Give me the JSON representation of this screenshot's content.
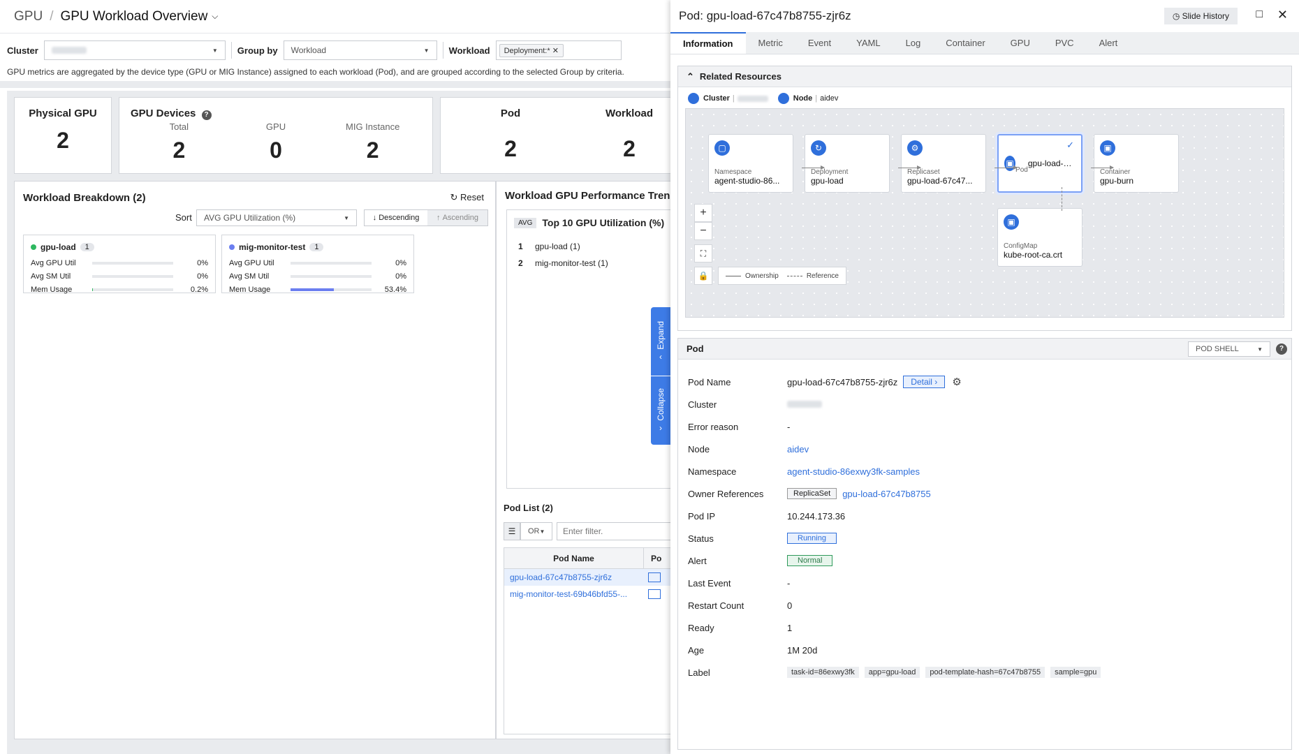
{
  "header": {
    "crumb": "GPU",
    "title": "GPU Workload Overview"
  },
  "filters": {
    "cluster_label": "Cluster",
    "groupby_label": "Group by",
    "groupby_value": "Workload",
    "workload_label": "Workload",
    "workload_tag": "Deployment:*"
  },
  "note": "GPU metrics are aggregated by the device type (GPU or MIG Instance) assigned to each workload (Pod), and are grouped according to the selected Group by criteria.",
  "stats": {
    "physical_gpu_label": "Physical GPU",
    "physical_gpu": "2",
    "devices_label": "GPU Devices",
    "total_label": "Total",
    "total": "2",
    "gpu_label": "GPU",
    "gpu": "0",
    "mig_label": "MIG Instance",
    "mig": "2",
    "pod_label": "Pod",
    "pod": "2",
    "workload_label": "Workload",
    "workload": "2"
  },
  "breakdown": {
    "title": "Workload Breakdown (2)",
    "reset": "Reset",
    "sort_label": "Sort",
    "sort_value": "AVG GPU Utilization (%)",
    "descending": "Descending",
    "ascending": "Ascending",
    "cards": [
      {
        "name": "gpu-load",
        "count": "1",
        "dot": "#2eb860",
        "rows": [
          {
            "k": "Avg GPU Util",
            "v": "0%",
            "fill": 0
          },
          {
            "k": "Avg SM Util",
            "v": "0%",
            "fill": 0
          },
          {
            "k": "Mem Usage",
            "v": "0.2%",
            "fill": 0.002
          }
        ]
      },
      {
        "name": "mig-monitor-test",
        "count": "1",
        "dot": "#6b7ef0",
        "rows": [
          {
            "k": "Avg GPU Util",
            "v": "0%",
            "fill": 0
          },
          {
            "k": "Avg SM Util",
            "v": "0%",
            "fill": 0
          },
          {
            "k": "Mem Usage",
            "v": "53.4%",
            "fill": 0.534
          }
        ]
      }
    ]
  },
  "trend": {
    "title": "Workload GPU Performance Trend",
    "avg_tag": "AVG",
    "subtitle": "Top 10 GPU Utilization (%)",
    "items": [
      {
        "rank": "1",
        "name": "gpu-load (1)"
      },
      {
        "rank": "2",
        "name": "mig-monitor-test (1)"
      }
    ],
    "expand": "Expand",
    "collapse": "Collapse"
  },
  "podlist": {
    "title": "Pod List (2)",
    "or": "OR",
    "filter_placeholder": "Enter filter.",
    "col_name": "Pod Name",
    "col_status": "Po",
    "rows": [
      "gpu-load-67c47b8755-zjr6z",
      "mig-monitor-test-69b46bfd55-..."
    ]
  },
  "detail": {
    "title": "Pod: gpu-load-67c47b8755-zjr6z",
    "slide_history": "Slide History",
    "tabs": [
      "Information",
      "Metric",
      "Event",
      "YAML",
      "Log",
      "Container",
      "GPU",
      "PVC",
      "Alert"
    ],
    "related_title": "Related Resources",
    "cluster_label": "Cluster",
    "node_label": "Node",
    "node_value": "aidev",
    "nodes": [
      {
        "kind": "Namespace",
        "name": "agent-studio-86..."
      },
      {
        "kind": "Deployment",
        "name": "gpu-load"
      },
      {
        "kind": "Replicaset",
        "name": "gpu-load-67c47..."
      },
      {
        "kind": "Pod",
        "name": "gpu-load-67c47..."
      },
      {
        "kind": "Container",
        "name": "gpu-burn"
      },
      {
        "kind": "ConfigMap",
        "name": "kube-root-ca.crt"
      }
    ],
    "legend_ownership": "Ownership",
    "legend_reference": "Reference",
    "pod_section": "Pod",
    "pod_shell": "POD SHELL",
    "fields": {
      "pod_name_k": "Pod Name",
      "pod_name": "gpu-load-67c47b8755-zjr6z",
      "detail_btn": "Detail",
      "cluster_k": "Cluster",
      "error_k": "Error reason",
      "error": "-",
      "node_k": "Node",
      "node": "aidev",
      "ns_k": "Namespace",
      "ns": "agent-studio-86exwy3fk-samples",
      "owner_k": "Owner References",
      "owner_kind": "ReplicaSet",
      "owner": "gpu-load-67c47b8755",
      "ip_k": "Pod IP",
      "ip": "10.244.173.36",
      "status_k": "Status",
      "status": "Running",
      "alert_k": "Alert",
      "alert": "Normal",
      "last_event_k": "Last Event",
      "last_event": "-",
      "restart_k": "Restart Count",
      "restart": "0",
      "ready_k": "Ready",
      "ready": "1",
      "age_k": "Age",
      "age": "1M 20d",
      "label_k": "Label",
      "labels": [
        "task-id=86exwy3fk",
        "app=gpu-load",
        "pod-template-hash=67c47b8755",
        "sample=gpu"
      ]
    }
  }
}
